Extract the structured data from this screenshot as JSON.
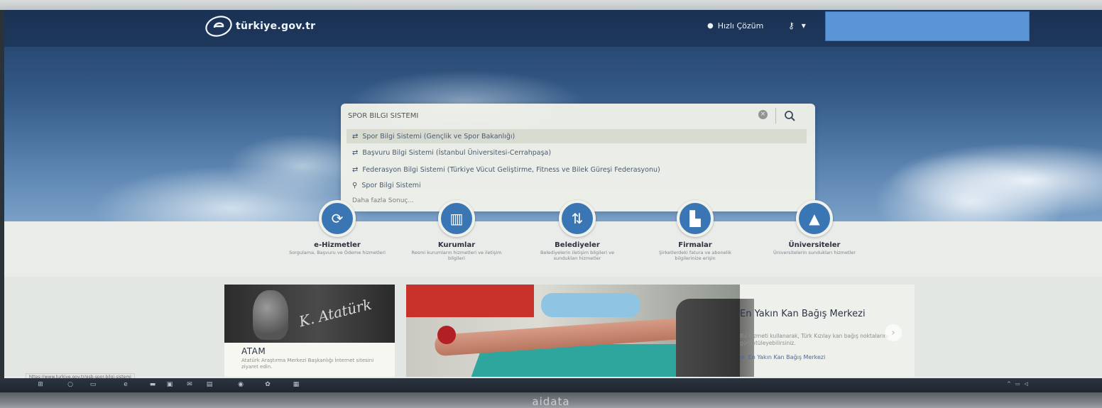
{
  "header": {
    "logo_text": "türkiye.gov.tr",
    "quick_solution_label": "Hızlı Çözüm",
    "key_menu_arrow": "▾"
  },
  "search": {
    "query": "SPOR BİLGİ SİSTEMİ",
    "suggestions": [
      {
        "icon": "e-service-icon",
        "label": "Spor Bilgi Sistemi (Gençlik ve Spor Bakanlığı)"
      },
      {
        "icon": "e-service-icon",
        "label": "Başvuru Bilgi Sistemi (İstanbul Üniversitesi-Cerrahpaşa)"
      },
      {
        "icon": "e-service-icon",
        "label": "Federasyon Bilgi Sistemi (Türkiye Vücut Geliştirme, Fitness ve Bilek Güreşi Federasyonu)"
      },
      {
        "icon": "search-icon",
        "label": "Spor Bilgi Sistemi"
      }
    ],
    "more_results": "Daha fazla Sonuç..."
  },
  "categories": [
    {
      "title": "e-Hizmetler",
      "desc": "Sorgulama, Başvuru ve Ödeme hizmetleri",
      "icon": "refresh-icon"
    },
    {
      "title": "Kurumlar",
      "desc": "Resmi kurumların hizmetleri ve iletişim bilgileri",
      "icon": "building-icon"
    },
    {
      "title": "Belediyeler",
      "desc": "Belediyelerin iletişim bilgileri ve sundukları hizmetler",
      "icon": "signpost-icon"
    },
    {
      "title": "Firmalar",
      "desc": "Şirketlerdeki fatura ve abonelik bilgilerinize erişin",
      "icon": "factory-icon"
    },
    {
      "title": "Üniversiteler",
      "desc": "Üniversitelerin sundukları hizmetler",
      "icon": "graduation-cap-icon"
    }
  ],
  "atam": {
    "title": "ATAM",
    "desc": "Atatürk Araştırma Merkezi Başkanlığı İnternet sitesini ziyaret edin."
  },
  "feature": {
    "title": "En Yakın Kan Bağış Merkezi",
    "desc": "Bu hizmeti kullanarak, Türk Kızılay kan bağış noktalarını görüntüleyebilirsiniz.",
    "link": "En Yakın Kan Bağış Merkezi"
  },
  "status_url": "https://www.turkiye.gov.tr/gsb-spor-bilgi-sistemi",
  "monitor_brand": "aidata",
  "colors": {
    "accent": "#3a75b4",
    "redacted_box": "#5b95d8"
  }
}
